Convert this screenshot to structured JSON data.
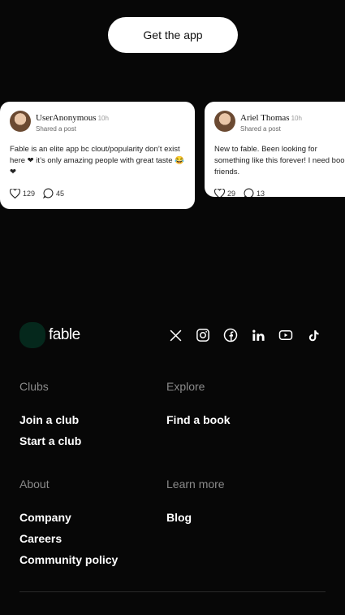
{
  "cta": {
    "label": "Get the app"
  },
  "posts": [
    {
      "user": "UserAnonymous",
      "time": "10h",
      "action": "Shared a post",
      "text": "Fable is an elite app bc clout/popularity don’t exist here ❤ it’s only amazing people with great taste 😂 ❤",
      "likes": "129",
      "comments": "45"
    },
    {
      "user": "Ariel Thomas",
      "time": "10h",
      "action": "Shared a post",
      "text": "New to fable. Been looking for something like this forever! I need book friends.",
      "likes": "29",
      "comments": "13"
    }
  ],
  "footer": {
    "brand": "fable",
    "brand_color": "#05281c",
    "socials": [
      "x-icon",
      "instagram-icon",
      "facebook-icon",
      "linkedin-icon",
      "youtube-icon",
      "tiktok-icon"
    ],
    "clubs": {
      "heading": "Clubs",
      "links": [
        "Join a club",
        "Start a club"
      ]
    },
    "explore": {
      "heading": "Explore",
      "links": [
        "Find a book"
      ]
    },
    "about": {
      "heading": "About",
      "links": [
        "Company",
        "Careers",
        "Community policy"
      ]
    },
    "learn": {
      "heading": "Learn more",
      "links": [
        "Blog"
      ]
    }
  }
}
